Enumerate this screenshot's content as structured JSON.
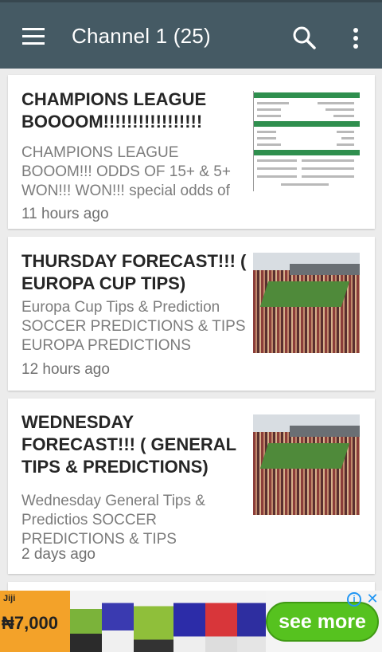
{
  "app_bar": {
    "title": "Channel 1 (25)",
    "menu_icon": "hamburger-menu-icon",
    "search_icon": "search-icon",
    "more_icon": "more-vert-icon",
    "background": "#455a64"
  },
  "posts": [
    {
      "headline": "CHAMPIONS LEAGUE BOOOOM!!!!!!!!!!!!!!!!!",
      "excerpt": "CHAMPIONS LEAGUE BOOOM!!! ODDS OF 15+ & 5+ WON!!! WON!!! special odds of",
      "time": "11 hours ago"
    },
    {
      "headline": "THURSDAY FORECAST!!! ( EUROPA CUP TIPS)",
      "excerpt": "Europa Cup Tips & Prediction SOCCER PREDICTIONS & TIPS EUROPA PREDICTIONS",
      "time": "12 hours ago"
    },
    {
      "headline": "WEDNESDAY FORECAST!!! ( GENERAL TIPS & PREDICTIONS)",
      "excerpt": "Wednesday General  Tips & Predictios SOCCER PREDICTIONS & TIPS",
      "time": "2 days ago"
    }
  ],
  "ad": {
    "brand": "Jiji",
    "price": "₦7,000",
    "cta": "see more",
    "info_icon": "info-icon",
    "close_icon": "close-icon",
    "cta_color": "#56c21f"
  }
}
